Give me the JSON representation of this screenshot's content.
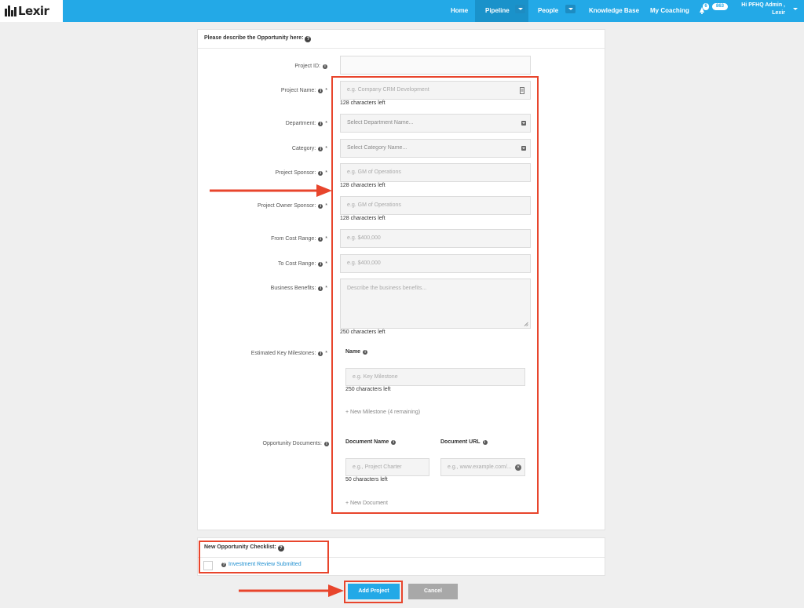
{
  "nav": {
    "logo": "Lexir",
    "items": [
      "Home",
      "Pipeline",
      "People",
      "Knowledge Base",
      "My Coaching"
    ],
    "notifications_count": "6",
    "messages_count": "863",
    "user_line1": "Hi PFHQ Admin ,",
    "user_line2": "Lexir"
  },
  "form": {
    "header": "Please describe the Opportunity here:",
    "project_id": {
      "label": "Project ID:",
      "value": ""
    },
    "project_name": {
      "label": "Project Name:",
      "placeholder": "e.g. Company CRM Development",
      "hint": "128 characters left"
    },
    "department": {
      "label": "Department:",
      "placeholder": "Select Department Name..."
    },
    "category": {
      "label": "Category:",
      "placeholder": "Select Category Name..."
    },
    "project_sponsor": {
      "label": "Project Sponsor:",
      "placeholder": "e.g. GM of Operations",
      "hint": "128 characters left"
    },
    "project_owner_sponsor": {
      "label": "Project Owner Sponsor:",
      "placeholder": "e.g. GM of Operations",
      "hint": "128 characters left"
    },
    "from_cost": {
      "label": "From Cost Range:",
      "placeholder": "e.g. $400,000"
    },
    "to_cost": {
      "label": "To Cost Range:",
      "placeholder": "e.g. $400,000"
    },
    "business_benefits": {
      "label": "Business Benefits:",
      "placeholder": "Describe the business benefits...",
      "hint": "250 characters left"
    },
    "milestones": {
      "label": "Estimated Key Milestones:",
      "name_header": "Name",
      "placeholder": "e.g. Key Milestone",
      "hint": "250 characters left",
      "add_link": "+ New Milestone (4 remaining)"
    },
    "documents": {
      "label": "Opportunity Documents:",
      "name_header": "Document Name",
      "url_header": "Document URL",
      "name_placeholder": "e.g., Project Charter",
      "url_placeholder": "e.g., www.example.com/...",
      "hint": "50 characters left",
      "add_link": "+ New Document"
    },
    "required_mark": "*"
  },
  "checklist": {
    "header": "New Opportunity Checklist:",
    "item": "Investment Review Submitted"
  },
  "actions": {
    "add": "Add Project",
    "cancel": "Cancel"
  },
  "colors": {
    "brand": "#23a9e7",
    "annotation": "#e8452c"
  }
}
